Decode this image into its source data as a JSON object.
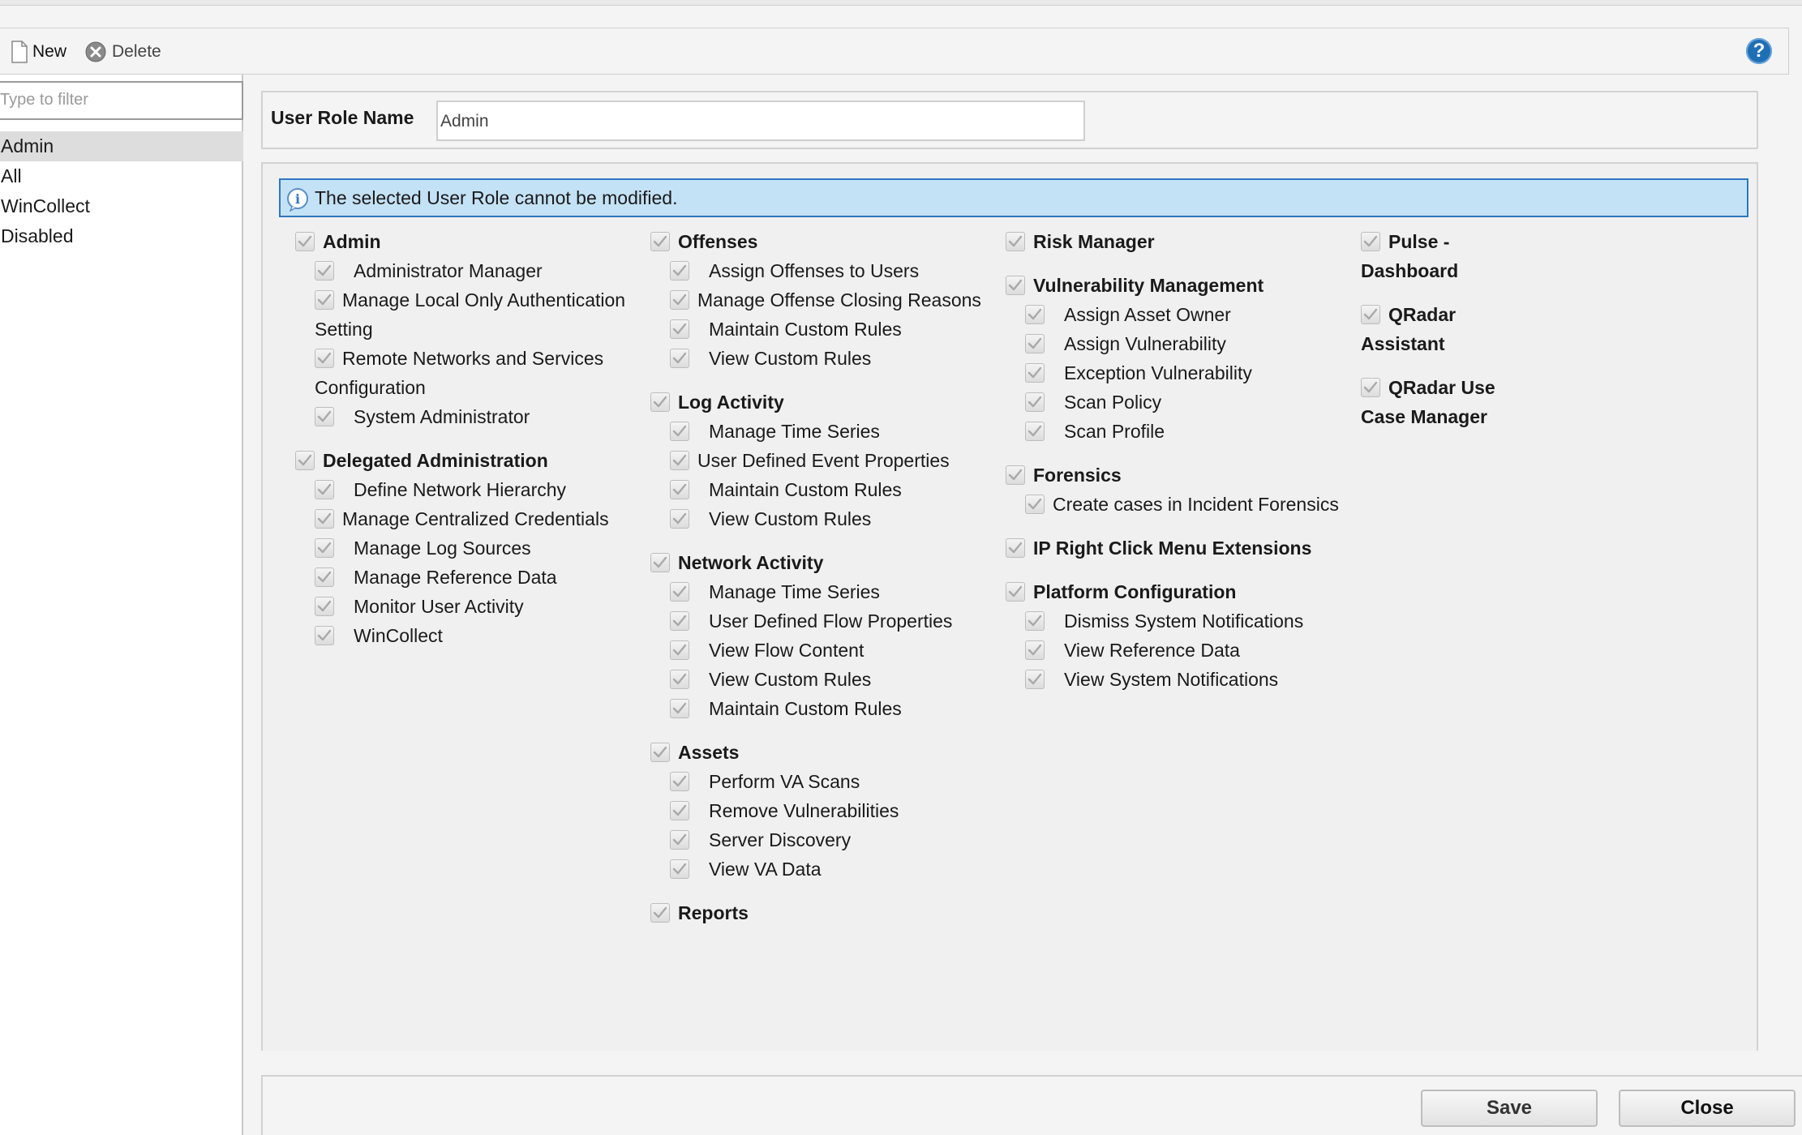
{
  "toolbar": {
    "new_label": "New",
    "delete_label": "Delete"
  },
  "sidebar": {
    "filter_placeholder": "Type to filter",
    "roles": [
      {
        "label": "Admin",
        "selected": true
      },
      {
        "label": "All",
        "selected": false
      },
      {
        "label": "WinCollect",
        "selected": false
      },
      {
        "label": "Disabled",
        "selected": false
      }
    ]
  },
  "role_name": {
    "label": "User Role Name",
    "value": "Admin"
  },
  "info_message": "The selected User Role cannot be modified.",
  "permissions": {
    "col1": [
      {
        "title": "Admin",
        "checked": true,
        "items": [
          {
            "label": "Administrator Manager",
            "checked": true
          },
          {
            "label": "Manage Local Only Authentication Setting",
            "checked": true
          },
          {
            "label": "Remote Networks and Services Configuration",
            "checked": true
          },
          {
            "label": "System Administrator",
            "checked": true
          }
        ]
      },
      {
        "title": "Delegated Administration",
        "checked": true,
        "items": [
          {
            "label": "Define Network Hierarchy",
            "checked": true
          },
          {
            "label": "Manage Centralized Credentials",
            "checked": true
          },
          {
            "label": "Manage Log Sources",
            "checked": true
          },
          {
            "label": "Manage Reference Data",
            "checked": true
          },
          {
            "label": "Monitor User Activity",
            "checked": true
          },
          {
            "label": "WinCollect",
            "checked": true
          }
        ]
      }
    ],
    "col2": [
      {
        "title": "Offenses",
        "checked": true,
        "items": [
          {
            "label": "Assign Offenses to Users",
            "checked": true
          },
          {
            "label": "Manage Offense Closing Reasons",
            "checked": true
          },
          {
            "label": "Maintain Custom Rules",
            "checked": true
          },
          {
            "label": "View Custom Rules",
            "checked": true
          }
        ]
      },
      {
        "title": "Log Activity",
        "checked": true,
        "items": [
          {
            "label": "Manage Time Series",
            "checked": true
          },
          {
            "label": "User Defined Event Properties",
            "checked": true
          },
          {
            "label": "Maintain Custom Rules",
            "checked": true
          },
          {
            "label": "View Custom Rules",
            "checked": true
          }
        ]
      },
      {
        "title": "Network Activity",
        "checked": true,
        "items": [
          {
            "label": "Manage Time Series",
            "checked": true
          },
          {
            "label": "User Defined Flow Properties",
            "checked": true
          },
          {
            "label": "View Flow Content",
            "checked": true
          },
          {
            "label": "View Custom Rules",
            "checked": true
          },
          {
            "label": "Maintain Custom Rules",
            "checked": true
          }
        ]
      },
      {
        "title": "Assets",
        "checked": true,
        "items": [
          {
            "label": "Perform VA Scans",
            "checked": true
          },
          {
            "label": "Remove Vulnerabilities",
            "checked": true
          },
          {
            "label": "Server Discovery",
            "checked": true
          },
          {
            "label": "View VA Data",
            "checked": true
          }
        ]
      },
      {
        "title": "Reports",
        "checked": true,
        "items": []
      }
    ],
    "col3": [
      {
        "title": "Risk Manager",
        "checked": true,
        "items": []
      },
      {
        "title": "Vulnerability Management",
        "checked": true,
        "items": [
          {
            "label": "Assign Asset Owner",
            "checked": true
          },
          {
            "label": "Assign Vulnerability",
            "checked": true
          },
          {
            "label": "Exception Vulnerability",
            "checked": true
          },
          {
            "label": "Scan Policy",
            "checked": true
          },
          {
            "label": "Scan Profile",
            "checked": true
          }
        ]
      },
      {
        "title": "Forensics",
        "checked": true,
        "items": [
          {
            "label": "Create cases in Incident Forensics",
            "checked": true
          }
        ]
      },
      {
        "title": "IP Right Click Menu Extensions",
        "checked": true,
        "items": []
      },
      {
        "title": "Platform Configuration",
        "checked": true,
        "items": [
          {
            "label": "Dismiss System Notifications",
            "checked": true
          },
          {
            "label": "View Reference Data",
            "checked": true
          },
          {
            "label": "View System Notifications",
            "checked": true
          }
        ]
      }
    ],
    "col4": [
      {
        "title": "Pulse - Dashboard",
        "checked": true,
        "items": []
      },
      {
        "title": "QRadar Assistant",
        "checked": true,
        "items": []
      },
      {
        "title": "QRadar Use Case Manager",
        "checked": true,
        "items": []
      }
    ]
  },
  "footer": {
    "save_label": "Save",
    "close_label": "Close"
  }
}
